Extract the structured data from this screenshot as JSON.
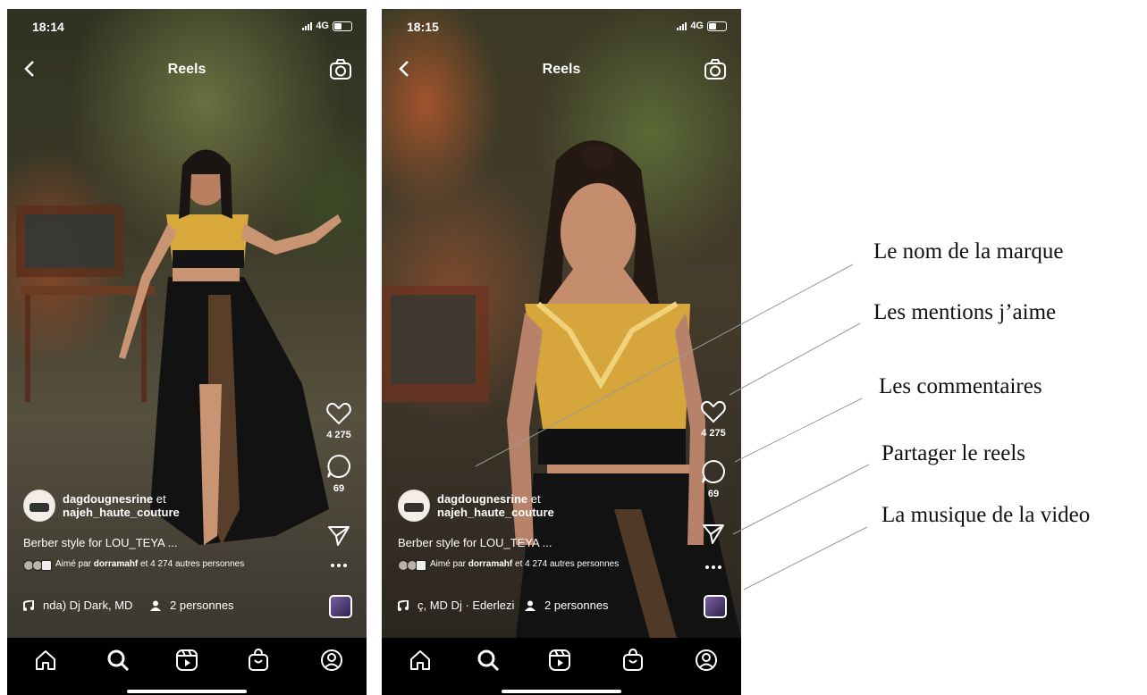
{
  "screens": [
    {
      "time": "18:14",
      "network": "4G",
      "title": "Reels",
      "likes": "4 275",
      "comments": "69",
      "user1": "dagdougnesrine",
      "joiner": "et",
      "user2": "najeh_haute_couture",
      "caption": "Berber style for LOU_TEYA ...",
      "liked_prefix": "Aimé par",
      "liked_user": "dorramahf",
      "liked_suffix": "et 4 274 autres personnes",
      "song": "nda)  Dj Dark, MD",
      "people": "2 personnes"
    },
    {
      "time": "18:15",
      "network": "4G",
      "title": "Reels",
      "likes": "4 275",
      "comments": "69",
      "user1": "dagdougnesrine",
      "joiner": "et",
      "user2": "najeh_haute_couture",
      "caption": "Berber style for LOU_TEYA ...",
      "liked_prefix": "Aimé par",
      "liked_user": "dorramahf",
      "liked_suffix": "et 4 274 autres personnes",
      "song": "ç, MD Dj · Ederlezi",
      "people": "2 personnes"
    }
  ],
  "annotations": [
    "Le nom de la marque",
    "Les mentions j’aime",
    "Les commentaires",
    "Partager le reels",
    "La musique de la video"
  ],
  "icons": {
    "back": "chevron-left-icon",
    "camera": "camera-icon",
    "like": "heart-icon",
    "comment": "comment-icon",
    "share": "send-icon",
    "more": "more-icon",
    "music": "music-note-icon",
    "people": "person-icon",
    "nav": [
      "home-icon",
      "search-icon",
      "reels-icon",
      "shop-icon",
      "profile-icon"
    ]
  },
  "colors": {
    "nav_bar": "#000000",
    "annotation_line": "#9a9a9a",
    "page_bg": "#ffffff"
  }
}
